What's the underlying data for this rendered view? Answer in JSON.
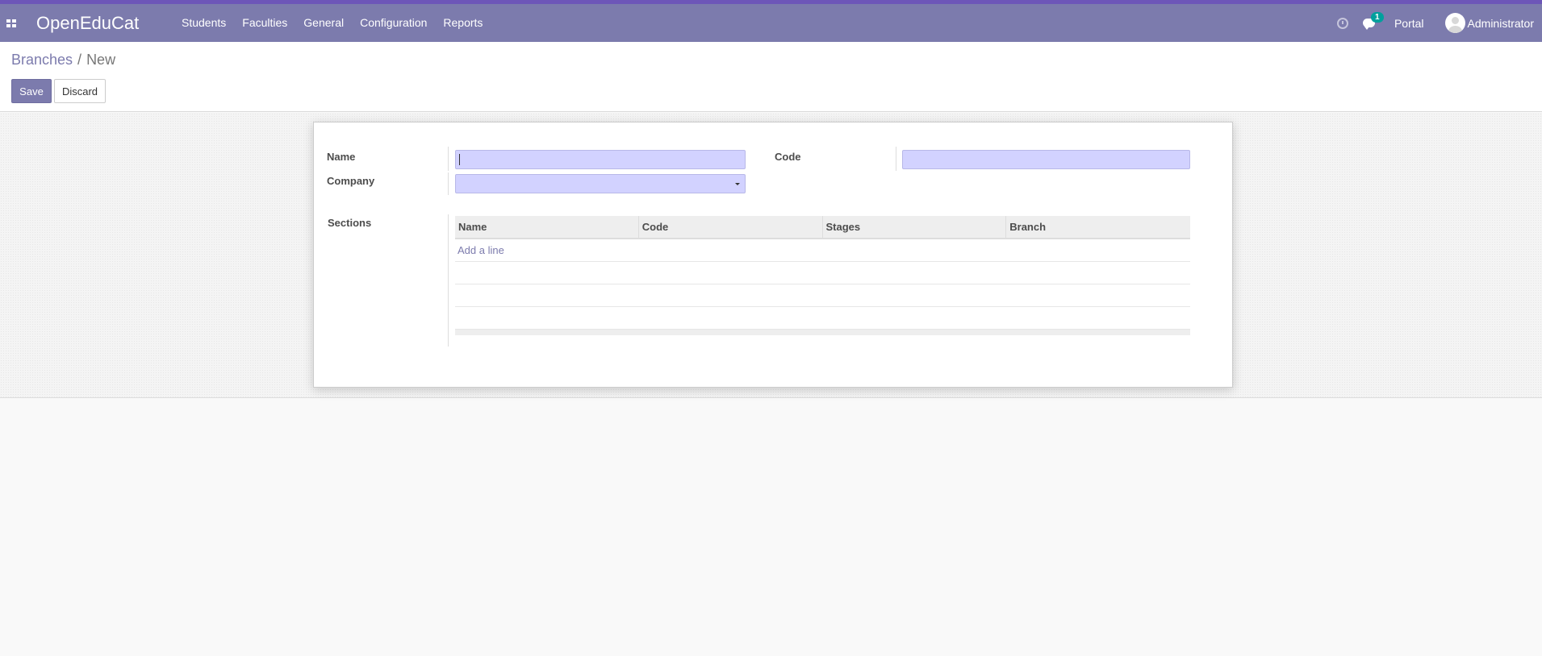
{
  "navbar": {
    "apps_icon": "apps-grid-icon",
    "brand": "OpenEduCat",
    "menu": [
      "Students",
      "Faculties",
      "General",
      "Configuration",
      "Reports"
    ],
    "messages_badge": "1",
    "portal": "Portal",
    "user_name": "Administrator"
  },
  "breadcrumb": {
    "parent": "Branches",
    "separator": "/",
    "current": "New"
  },
  "actions": {
    "save_label": "Save",
    "discard_label": "Discard"
  },
  "form": {
    "name_label": "Name",
    "name_value": "",
    "code_label": "Code",
    "code_value": "",
    "company_label": "Company",
    "company_value": "",
    "sections_label": "Sections",
    "sections_table": {
      "columns": [
        "Name",
        "Code",
        "Stages",
        "Branch"
      ],
      "add_line_label": "Add a line",
      "rows": []
    }
  },
  "colors": {
    "brand": "#7c7bad",
    "navbar_top_border": "#6d56b8",
    "required_field_bg": "#d2d2ff",
    "badge": "#00a09d"
  }
}
